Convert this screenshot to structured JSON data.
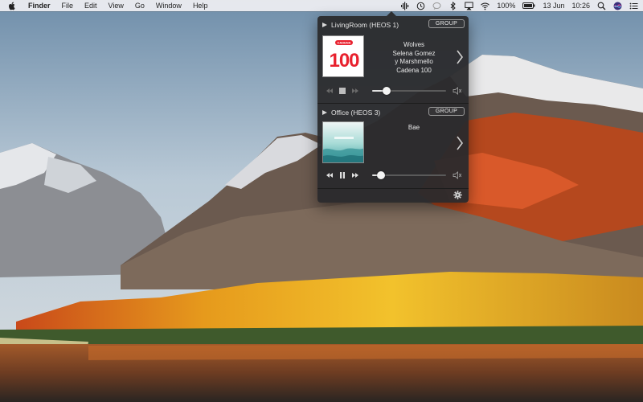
{
  "menubar": {
    "app_name": "Finder",
    "menus": [
      "File",
      "Edit",
      "View",
      "Go",
      "Window",
      "Help"
    ],
    "battery_percent": "100%",
    "date": "13 Jun",
    "time": "10:26"
  },
  "popover": {
    "zones": [
      {
        "name": "LivingRoom (HEOS 1)",
        "group_label": "GROUP",
        "track_lines": [
          "Wolves",
          "Selena Gomez",
          "y Marshmello",
          "Cadena 100"
        ],
        "album_art_text": "100",
        "album_art_small": "CADENA",
        "volume": 0.2,
        "playing": false
      },
      {
        "name": "Office (HEOS 3)",
        "group_label": "GROUP",
        "track_lines": [
          "Bae"
        ],
        "volume": 0.12,
        "playing": true
      }
    ]
  },
  "colors": {
    "accent_red": "#e8212e",
    "popover_bg": "#2a2a2c"
  },
  "icons": {
    "apple": "apple-logo-icon",
    "settings": "gear-icon",
    "speaker": "speaker-icon",
    "next": "chevron-right-icon"
  }
}
